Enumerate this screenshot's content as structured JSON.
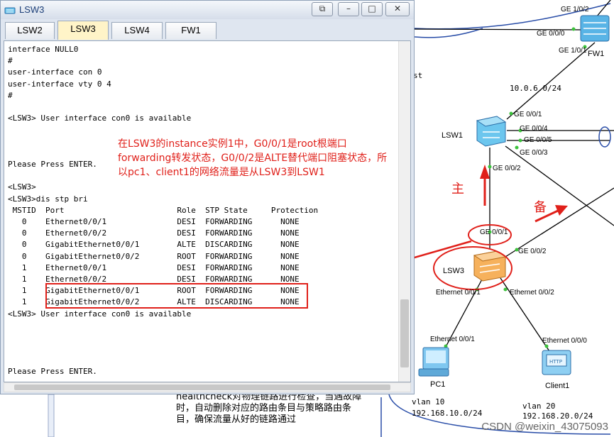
{
  "window": {
    "title": "LSW3",
    "buttons": {
      "restore": "⧉",
      "minimize": "–",
      "maximize": "□",
      "close": "✕"
    }
  },
  "tabs": [
    "LSW2",
    "LSW3",
    "LSW4",
    "FW1"
  ],
  "active_tab": "LSW3",
  "console_lines": [
    "interface NULL0",
    "#",
    "user-interface con 0",
    "user-interface vty 0 4",
    "#",
    "",
    "<LSW3> User interface con0 is available",
    "",
    "",
    "",
    "Please Press ENTER.",
    "",
    "<LSW3>",
    "<LSW3>dis stp bri",
    " MSTID  Port                        Role  STP State     Protection",
    "   0    Ethernet0/0/1               DESI  FORWARDING      NONE",
    "   0    Ethernet0/0/2               DESI  FORWARDING      NONE",
    "   0    GigabitEthernet0/0/1        ALTE  DISCARDING      NONE",
    "   0    GigabitEthernet0/0/2        ROOT  FORWARDING      NONE",
    "   1    Ethernet0/0/1               DESI  FORWARDING      NONE",
    "   1    Ethernet0/0/2               DESI  FORWARDING      NONE",
    "   1    GigabitEthernet0/0/1        ROOT  FORWARDING      NONE",
    "   1    GigabitEthernet0/0/2        ALTE  DISCARDING      NONE",
    "<LSW3> User interface con0 is available",
    "",
    "",
    "",
    "",
    "Please Press ENTER."
  ],
  "annotation": "在LSW3的instance实例1中，G0/0/1是root根端口forwarding转发状态，G0/0/2是ALTE替代端口阻塞状态，所以pc1、client1的网络流量是从LSW3到LSW1",
  "topology": {
    "devices": {
      "fw1": "FW1",
      "lsw1": "LSW1",
      "lsw3": "LSW3",
      "pc1": "PC1",
      "client1": "Client1"
    },
    "ports": {
      "fw_ge102": "GE 1/0/2",
      "fw_ge000": "GE 0/0/0",
      "fw_ge101": "GE 1/0/1",
      "lsw1_ge001": "GE 0/0/1",
      "lsw1_ge004": "GE 0/0/4",
      "lsw1_ge005": "GE 0/0/5",
      "lsw1_ge003": "GE 0/0/3",
      "lsw1_ge002": "GE 0/0/2",
      "lsw3_ge001": "GE 0/0/1",
      "lsw3_ge002": "GE 0/0/2",
      "lsw3_eth001": "Ethernet 0/0/1",
      "lsw3_eth002": "Ethernet 0/0/2",
      "pc1_eth": "Ethernet 0/0/1",
      "client1_eth": "Ethernet 0/0/0"
    },
    "subnet": "10.0.6.0/24",
    "partial_label": "st",
    "main_label": "主",
    "backup_label": "备",
    "vlan10": "vlan 10",
    "vlan10_net": "192.168.10.0/24",
    "vlan20": "vlan 20",
    "vlan20_net": "192.168.20.0/24"
  },
  "bottom_note": "healthcheck对物理链路进行检查，当遇故障时，自动删除对应的路由条目与策略路由条目，确保流量从好的链路通过",
  "watermark": "CSDN @weixin_43075093",
  "colors": {
    "annotation": "#e0201a",
    "link_dot": "#3cc23c",
    "boundary": "#2a4ea8"
  }
}
